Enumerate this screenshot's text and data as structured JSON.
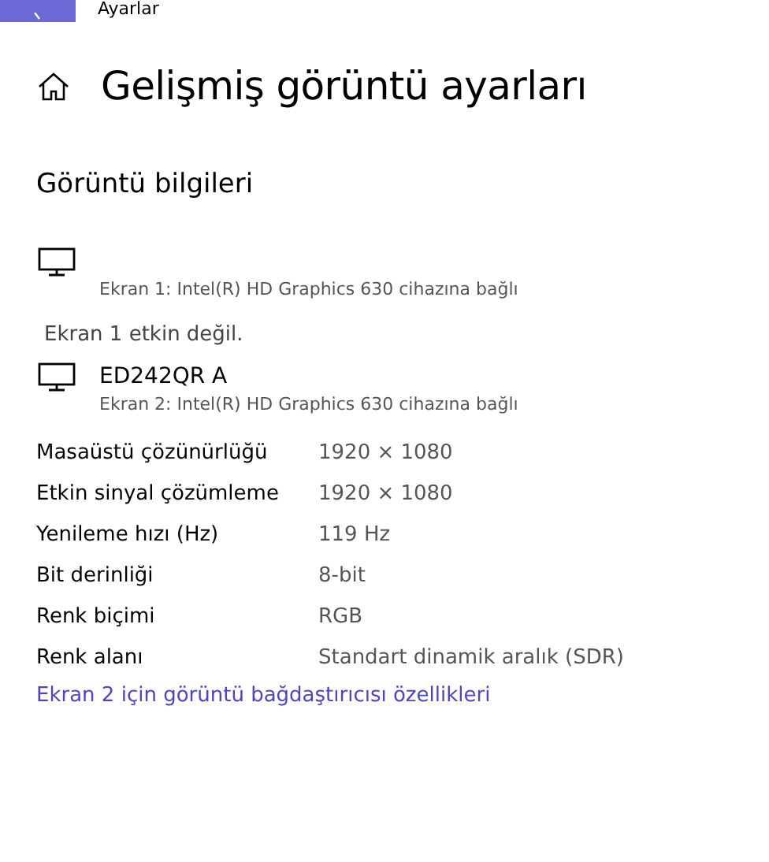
{
  "window": {
    "title": "Ayarlar"
  },
  "page_title": "Gelişmiş görüntü ayarları",
  "section_title": "Görüntü bilgileri",
  "displays": [
    {
      "subtitle": "Ekran 1: Intel(R) HD Graphics 630 cihazına bağlı",
      "note": "Ekran 1 etkin değil."
    },
    {
      "name": "ED242QR A",
      "subtitle": "Ekran 2: Intel(R) HD Graphics 630 cihazına bağlı"
    }
  ],
  "properties": [
    {
      "label": "Masaüstü çözünürlüğü",
      "value": "1920 × 1080"
    },
    {
      "label": "Etkin sinyal çözümleme",
      "value": "1920 × 1080"
    },
    {
      "label": "Yenileme hızı (Hz)",
      "value": "119 Hz"
    },
    {
      "label": "Bit derinliği",
      "value": "8-bit"
    },
    {
      "label": "Renk biçimi",
      "value": "RGB"
    },
    {
      "label": "Renk alanı",
      "value": "Standart dinamik aralık (SDR)"
    }
  ],
  "link": "Ekran 2 için görüntü bağdaştırıcısı özellikleri"
}
